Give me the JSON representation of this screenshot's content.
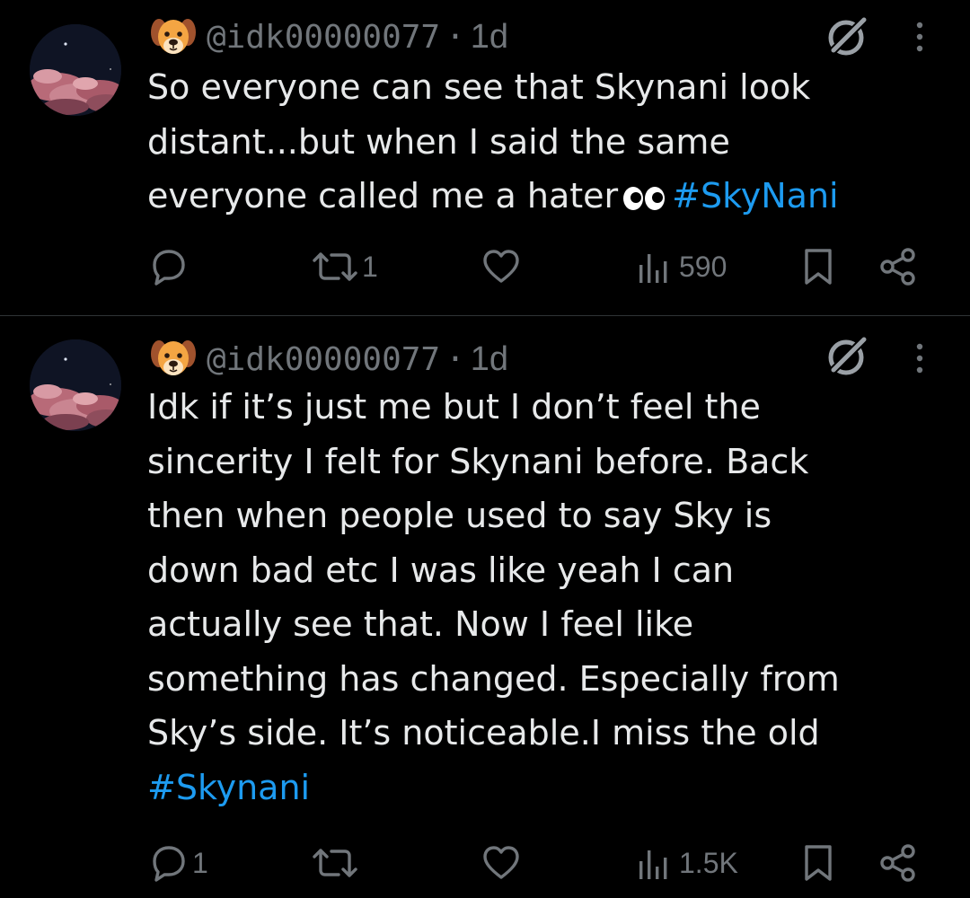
{
  "posts": [
    {
      "handle": "@idk00000077",
      "separator": "·",
      "time": "1d",
      "lines": [
        "So everyone can see that Skynani look",
        "distant...but when I said the same",
        "everyone called me a hater"
      ],
      "hashtag": "#SkyNani",
      "reply_count": "",
      "repost_count": "1",
      "like_count": "",
      "views": "590"
    },
    {
      "handle": "@idk00000077",
      "separator": "·",
      "time": "1d",
      "lines": [
        "Idk if it’s just me but I don’t feel the",
        "sincerity I felt for Skynani before. Back",
        "then when people used to say Sky is",
        "down bad etc I was like yeah I can",
        "actually see that. Now I feel like",
        "something has changed. Especially from",
        "Sky’s side. It’s noticeable.I miss the old"
      ],
      "hashtag": "#Skynani",
      "reply_count": "1",
      "repost_count": "",
      "like_count": "",
      "views": "1.5K"
    }
  ],
  "icons": {
    "author_badge": "dog-face-icon",
    "grok": "grok-icon",
    "more": "more-vertical-icon",
    "reply": "reply-icon",
    "repost": "repost-icon",
    "like": "heart-icon",
    "views": "views-chart-icon",
    "bookmark": "bookmark-icon",
    "share": "share-icon",
    "eyes": "eyes-emoji-icon"
  },
  "colors": {
    "background": "#000000",
    "text": "#e7e9ea",
    "secondary": "#71767b",
    "hashtag": "#1d9bf0",
    "divider": "#2f3336"
  }
}
